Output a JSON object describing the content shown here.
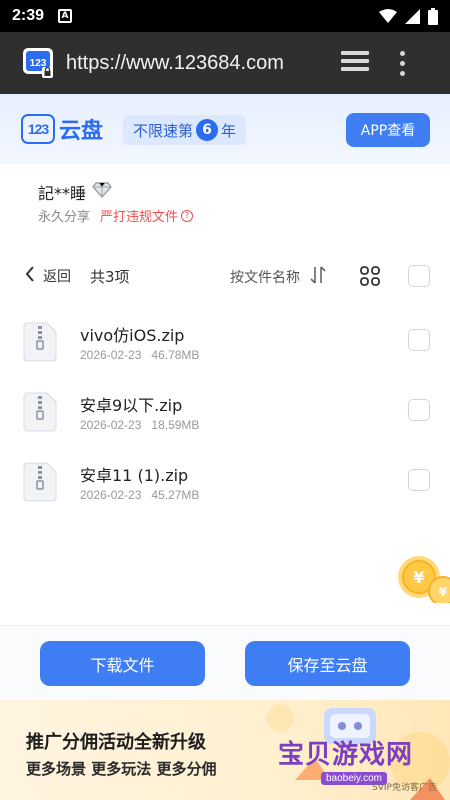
{
  "status_bar": {
    "time": "2:39",
    "notification_glyph": "A"
  },
  "browser": {
    "url": "https://www.123684.com"
  },
  "app": {
    "logo_mark": "123",
    "logo_text": "云盘",
    "promo_prefix": "不限速第",
    "promo_number": "6",
    "promo_suffix": "年",
    "app_button": "APP查看",
    "accent_color": "#3f7df2"
  },
  "share": {
    "sharer_name": "記**睡",
    "permanence": "永久分享",
    "report_link": "严打违规文件",
    "help_glyph": "?"
  },
  "toolbar": {
    "back_label": "返回",
    "count_label": "共3项",
    "sort_label": "按文件名称"
  },
  "files": [
    {
      "name": "vivo仿iOS.zip",
      "date": "2026-02-23",
      "size": "46.78MB"
    },
    {
      "name": "安卓9以下.zip",
      "date": "2026-02-23",
      "size": "18.59MB"
    },
    {
      "name": "安卓11 (1).zip",
      "date": "2026-02-23",
      "size": "45.27MB"
    }
  ],
  "actions": {
    "download_label": "下载文件",
    "save_label": "保存至云盘"
  },
  "ad": {
    "title": "推广分佣活动全新升级",
    "subtitle": "更多场景 更多玩法 更多分佣",
    "note": "SVIP免访客广告",
    "watermark_title": "宝贝游戏网",
    "watermark_url": "baobeiy.com"
  },
  "icons": {
    "status": [
      "notification-a-icon",
      "wifi-icon",
      "signal-icon",
      "battery-icon"
    ],
    "browser": [
      "site-favicon-icon",
      "tabs-icon",
      "overflow-menu-icon"
    ],
    "toolbar": [
      "back-arrow-icon",
      "sort-icon",
      "grid-view-icon"
    ],
    "file": "zip-file-icon"
  }
}
